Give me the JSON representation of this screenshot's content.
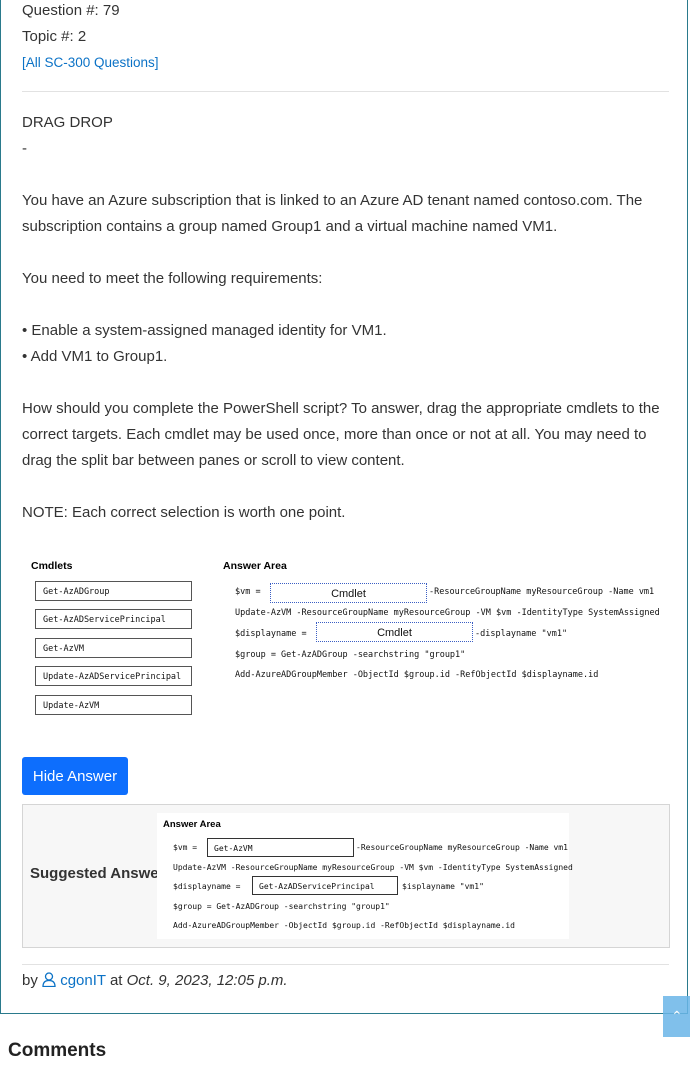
{
  "question": {
    "number_label": "Question #: 79",
    "topic_label": "Topic #: 2",
    "all_questions_link": "[All SC-300 Questions]"
  },
  "body": {
    "type_label": "DRAG DROP",
    "dash": "-",
    "para1": "You have an Azure subscription that is linked to an Azure AD tenant named contoso.com. The subscription contains a group named Group1 and a virtual machine named VM1.",
    "para2": "You need to meet the following requirements:",
    "req1": "• Enable a system-assigned managed identity for VM1.",
    "req2": "• Add VM1 to Group1.",
    "para3": "How should you complete the PowerShell script? To answer, drag the appropriate cmdlets to the correct targets. Each cmdlet may be used once, more than once or not at all. You may need to drag the split bar between panes or scroll to view content.",
    "note": "NOTE: Each correct selection is worth one point."
  },
  "figure": {
    "cmdlets_header": "Cmdlets",
    "answer_area_header": "Answer Area",
    "cmdlets": [
      "Get-AzADGroup",
      "Get-AzADServicePrincipal",
      "Get-AzVM",
      "Update-AzADServicePrincipal",
      "Update-AzVM"
    ],
    "line1_prefix": "$vm =",
    "target_label": "Cmdlet",
    "line1_suffix": "-ResourceGroupName myResourceGroup -Name vm1",
    "line2": "Update-AzVM -ResourceGroupName myResourceGroup -VM $vm -IdentityType SystemAssigned",
    "line3_prefix": "$displayname =",
    "line3_suffix": "-displayname \"vm1\"",
    "line4": "$group = Get-AzADGroup -searchstring \"group1\"",
    "line5": "Add-AzureADGroupMember -ObjectId $group.id -RefObjectId $displayname.id"
  },
  "hide_answer_button": "Hide Answer",
  "suggested": {
    "label": "Suggested Answer:",
    "answer_area_header": "Answer Area",
    "line1_prefix": "$vm =",
    "answer1": "Get-AzVM",
    "line1_suffix": "-ResourceGroupName myResourceGroup -Name vm1",
    "line2": "Update-AzVM -ResourceGroupName myResourceGroup -VM $vm -IdentityType SystemAssigned",
    "line3_prefix": "$displayname =",
    "answer2": "Get-AzADServicePrincipal",
    "line3_suffix": "$isplayname \"vm1\"",
    "line4": "$group = Get-AzADGroup -searchstring \"group1\"",
    "line5": "Add-AzureADGroupMember -ObjectId $group.id -RefObjectId $displayname.id"
  },
  "byline": {
    "by": "by",
    "user": "cgonIT",
    "at": "at",
    "date": "Oct. 9, 2023, 12:05 p.m."
  },
  "comments_heading": "Comments",
  "colors": {
    "link": "#0b72c6",
    "button": "#0d6efd",
    "card_border": "#2a7a8c"
  }
}
